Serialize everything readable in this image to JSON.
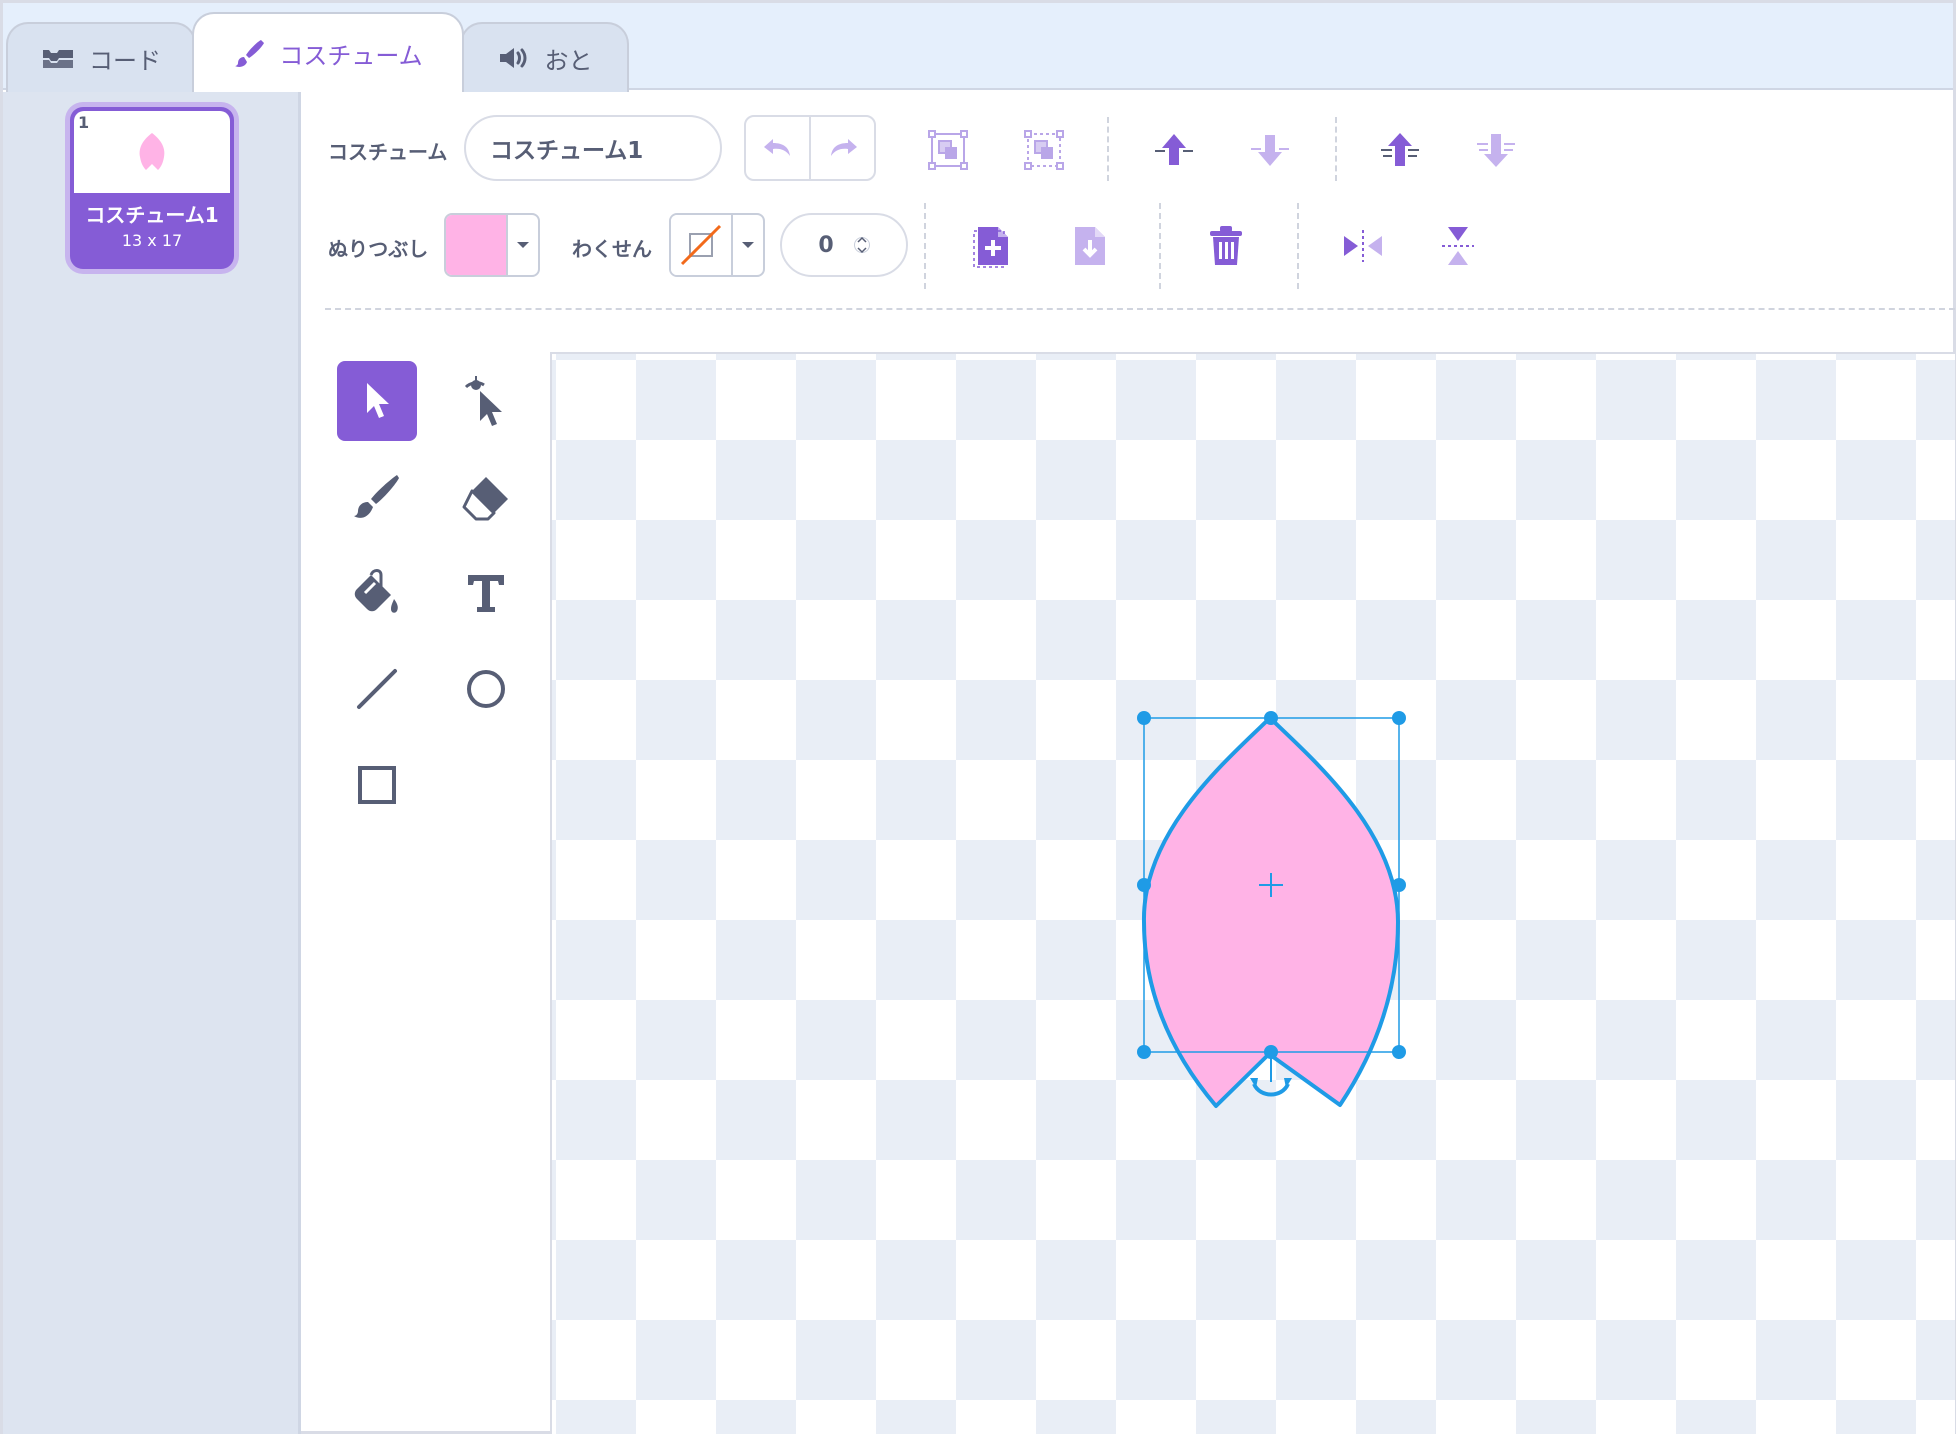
{
  "tabs": [
    {
      "label": "コード",
      "icon": "code-blocks-icon"
    },
    {
      "label": "コスチューム",
      "icon": "paintbrush-icon",
      "active": true
    },
    {
      "label": "おと",
      "icon": "speaker-icon"
    }
  ],
  "costume_list": {
    "items": [
      {
        "number": "1",
        "name": "コスチューム1",
        "size": "13 x 17",
        "selected": true
      }
    ]
  },
  "toolbar": {
    "costume_label": "コスチューム",
    "costume_name": "コスチューム1",
    "fill_label": "ぬりつぶし",
    "fill_color": "#ffb3e6",
    "outline_label": "わくせん",
    "outline_color": "none",
    "outline_width": "0",
    "actions": [
      "undo",
      "redo",
      "group",
      "ungroup",
      "forward",
      "backward",
      "front",
      "back",
      "copy",
      "paste",
      "delete",
      "flip-horizontal",
      "flip-vertical"
    ]
  },
  "tools": {
    "items": [
      "select",
      "reshape",
      "brush",
      "eraser",
      "fill",
      "text",
      "line",
      "circle",
      "rectangle"
    ],
    "active": "select"
  },
  "colors": {
    "accent": "#855cd6",
    "accent_light": "#c7b4ee",
    "shape_fill": "#ffb3e6",
    "selection": "#1f9be6",
    "checker": "#e9eef6",
    "text": "#575e75"
  }
}
